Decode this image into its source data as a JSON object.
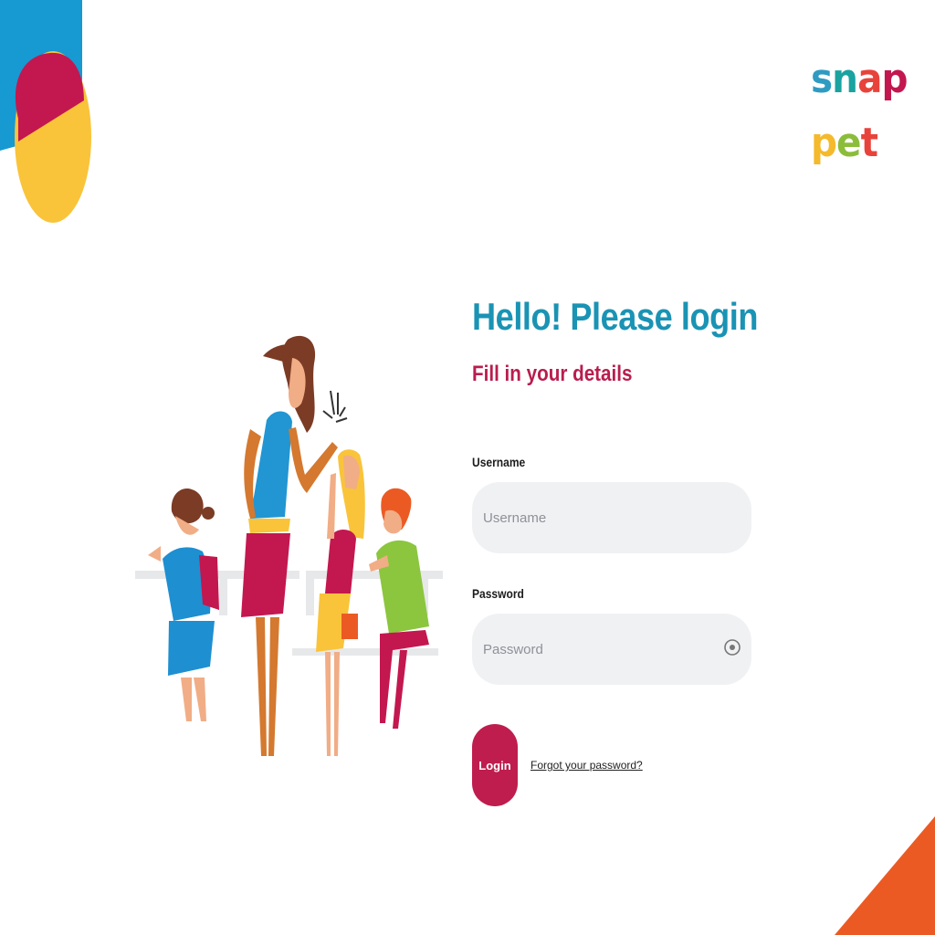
{
  "brand": {
    "logo_letters": [
      {
        "char": "s",
        "color": "#2f9bc2"
      },
      {
        "char": "n",
        "color": "#1aa3a0"
      },
      {
        "char": "a",
        "color": "#e8433b"
      },
      {
        "char": "p",
        "color": "#c3174f"
      },
      {
        "char": "p",
        "color": "#f5b92c"
      },
      {
        "char": "e",
        "color": "#8bbd3a"
      },
      {
        "char": "t",
        "color": "#e8433b"
      }
    ]
  },
  "login": {
    "title": "Hello! Please login",
    "subtitle": "Fill in your details",
    "username_label": "Username",
    "username_placeholder": "Username",
    "username_value": "",
    "password_label": "Password",
    "password_placeholder": "Password",
    "password_value": "",
    "show_password_icon": "eye-icon",
    "login_button": "Login",
    "forgot_password": "Forgot your password?"
  },
  "colors": {
    "title": "#1a93b4",
    "subtitle": "#b91d4e",
    "login_button": "#bf1d4e",
    "input_background": "#f0f1f3",
    "corner_blue": "#1799d2",
    "corner_red": "#c3174f",
    "corner_yellow": "#f9c43a",
    "corner_orange": "#ec5a23"
  }
}
